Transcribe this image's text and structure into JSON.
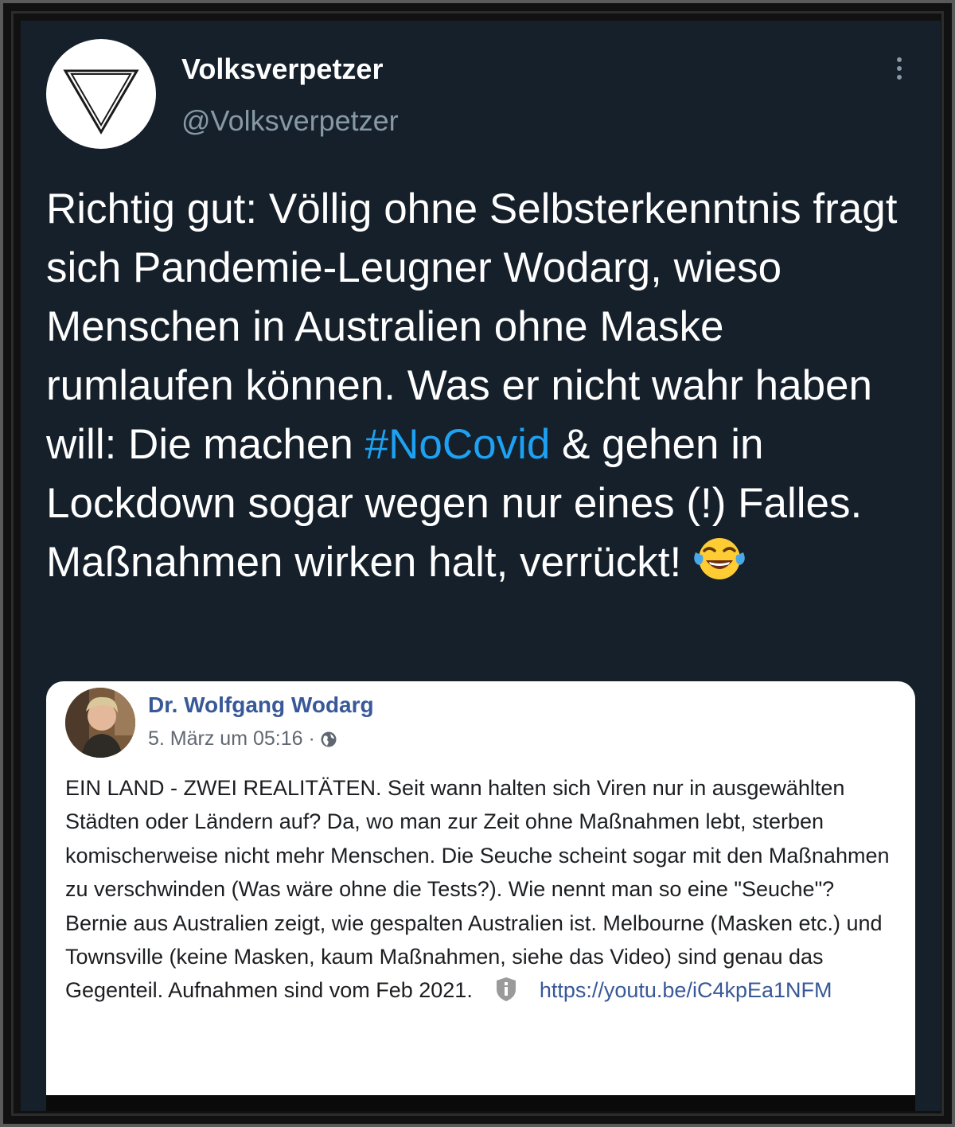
{
  "tweet": {
    "author": {
      "display_name": "Volksverpetzer",
      "handle": "@Volksverpetzer"
    },
    "text_before_hashtag": "Richtig gut: Völlig ohne Selbsterkenntnis fragt sich Pandemie-Leugner Wodarg, wieso Menschen in Australien ohne Maske rumlaufen können. Was er nicht wahr haben will: Die machen ",
    "hashtag": "#NoCovid",
    "text_after_hashtag": " & gehen in Lockdown sogar wegen nur eines (!) Falles. Maßnahmen wirken halt, verrückt! ",
    "emoji": "face-with-tears-of-joy",
    "more_icon": "more-vertical-icon"
  },
  "embedded_post": {
    "author_name": "Dr. Wolfgang Wodarg",
    "timestamp": "5. März um 05:16 ·",
    "visibility_icon": "globe-icon",
    "body_text": "EIN LAND - ZWEI REALITÄTEN. Seit wann halten sich Viren nur in ausgewählten Städten oder Ländern auf? Da, wo man zur Zeit ohne Maßnahmen lebt, sterben komischerweise nicht mehr Menschen. Die Seuche scheint sogar mit den Maßnahmen zu verschwinden (Was wäre ohne die Tests?). Wie nennt man so eine \"Seuche\"? Bernie aus Australien zeigt, wie gespalten Australien ist. Melbourne (Masken etc.) und Townsville (keine Masken, kaum Maßnahmen, siehe das Video) sind genau das Gegenteil. Aufnahmen sind vom Feb 2021.",
    "info_icon": "info-icon",
    "link_text": "https://youtu.be/iC4kpEa1NFM"
  },
  "colors": {
    "tweet_background": "#15202b",
    "hashtag": "#1da1f2",
    "secondary_text": "#8899a6",
    "facebook_link": "#385898"
  }
}
